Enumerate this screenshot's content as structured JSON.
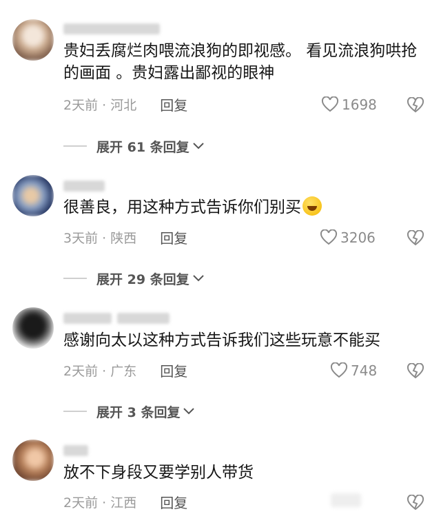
{
  "comments": [
    {
      "text": "贵妇丢腐烂肉喂流浪狗的即视感。 看见流浪狗哄抢的画面 。贵妇露出鄙视的眼神",
      "time_loc": "2天前 · 河北",
      "reply": "回复",
      "likes": "1698",
      "expand": "展开 61 条回复"
    },
    {
      "text": "很善良，用这种方式告诉你们别买",
      "time_loc": "3天前 · 陕西",
      "reply": "回复",
      "likes": "3206",
      "expand": "展开 29 条回复"
    },
    {
      "text": "感谢向太以这种方式告诉我们这些玩意不能买",
      "time_loc": "2天前 · 广东",
      "reply": "回复",
      "likes": "748",
      "expand": "展开 3 条回复"
    },
    {
      "text": "放不下身段又要学别人带货",
      "time_loc": "2天前 · 江西",
      "reply": "回复"
    }
  ],
  "icons": {
    "like": "heart-outline-icon",
    "dislike": "broken-heart-icon",
    "expand": "chevron-down-icon",
    "emoji": "rofl-emoji-icon"
  },
  "colors": {
    "meta_text": "#9a9a9a",
    "reply_text": "#555555",
    "body_text": "#161616"
  }
}
